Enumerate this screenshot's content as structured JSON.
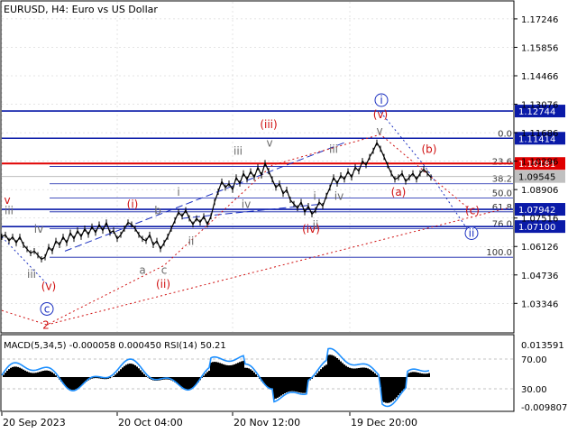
{
  "header": {
    "title": "EURUSD, H4:  Euro vs US Dollar",
    "indicator": "MACD(5,34,5) -0.000058 0.000450 RSI(14) 50.21"
  },
  "colors": {
    "price": "#000000",
    "blue_level": "#0a1aa8",
    "red_level": "#e00000",
    "wave_red": "#d01010",
    "wave_gray": "#6a6a6a",
    "wave_blue": "#1a2fc0",
    "rsi": "#1e90ff",
    "grid": "#c8c8c8"
  },
  "chart_data": {
    "type": "line",
    "symbol": "EURUSD",
    "timeframe": "H4",
    "y_ticks": [
      "1.17246",
      "1.15856",
      "1.14466",
      "1.13076",
      "1.11686",
      "1.10296",
      "1.08906",
      "1.07516",
      "1.06126",
      "1.04736",
      "1.03346"
    ],
    "ylim": [
      1.0195,
      1.1808
    ],
    "x_ticks": [
      "20 Sep 2023",
      "20 Oct 04:00",
      "20 Nov 12:00",
      "19 Dec 20:00"
    ],
    "price_labels": [
      {
        "text": "1.12744",
        "value": 1.12744,
        "style": "blue"
      },
      {
        "text": "1.11414",
        "value": 1.11414,
        "style": "blue"
      },
      {
        "text": "1.10181",
        "value": 1.10181,
        "style": "red"
      },
      {
        "text": "1.09545",
        "value": 1.09545,
        "style": "gray"
      },
      {
        "text": "1.07942",
        "value": 1.07942,
        "style": "blue"
      },
      {
        "text": "1.07100",
        "value": 1.071,
        "style": "blue"
      }
    ],
    "fib_levels": [
      {
        "label": "0.0",
        "value": 1.11414
      },
      {
        "label": "23.6",
        "value": 1.1004
      },
      {
        "label": "38.2",
        "value": 1.0919
      },
      {
        "label": "50.0",
        "value": 1.085
      },
      {
        "label": "61.8",
        "value": 1.0782
      },
      {
        "label": "76.0",
        "value": 1.0699
      },
      {
        "label": "100.0",
        "value": 1.056
      }
    ],
    "series": [
      {
        "type": "line",
        "values": [
          [
            0,
            1.066
          ],
          [
            4,
            1.067
          ],
          [
            8,
            1.064
          ],
          [
            12,
            1.066
          ],
          [
            16,
            1.063
          ],
          [
            20,
            1.066
          ],
          [
            24,
            1.062
          ],
          [
            28,
            1.06
          ],
          [
            32,
            1.058
          ],
          [
            36,
            1.059
          ],
          [
            40,
            1.057
          ],
          [
            44,
            1.055
          ],
          [
            48,
            1.056
          ],
          [
            52,
            1.061
          ],
          [
            56,
            1.059
          ],
          [
            60,
            1.064
          ],
          [
            64,
            1.062
          ],
          [
            68,
            1.066
          ],
          [
            72,
            1.063
          ],
          [
            76,
            1.068
          ],
          [
            80,
            1.065
          ],
          [
            84,
            1.069
          ],
          [
            88,
            1.066
          ],
          [
            92,
            1.07
          ],
          [
            96,
            1.067
          ],
          [
            100,
            1.071
          ],
          [
            104,
            1.068
          ],
          [
            108,
            1.072
          ],
          [
            112,
            1.069
          ],
          [
            116,
            1.073
          ],
          [
            120,
            1.068
          ],
          [
            124,
            1.069
          ],
          [
            128,
            1.065
          ],
          [
            132,
            1.067
          ],
          [
            136,
            1.07
          ],
          [
            140,
            1.073
          ],
          [
            144,
            1.072
          ],
          [
            148,
            1.07
          ],
          [
            152,
            1.067
          ],
          [
            156,
            1.065
          ],
          [
            160,
            1.064
          ],
          [
            164,
            1.067
          ],
          [
            168,
            1.062
          ],
          [
            172,
            1.064
          ],
          [
            176,
            1.06
          ],
          [
            180,
            1.063
          ],
          [
            184,
            1.066
          ],
          [
            188,
            1.07
          ],
          [
            192,
            1.074
          ],
          [
            196,
            1.078
          ],
          [
            200,
            1.076
          ],
          [
            204,
            1.079
          ],
          [
            208,
            1.075
          ],
          [
            212,
            1.072
          ],
          [
            216,
            1.075
          ],
          [
            220,
            1.073
          ],
          [
            224,
            1.076
          ],
          [
            228,
            1.072
          ],
          [
            232,
            1.076
          ],
          [
            236,
            1.083
          ],
          [
            240,
            1.088
          ],
          [
            244,
            1.093
          ],
          [
            248,
            1.09
          ],
          [
            252,
            1.092
          ],
          [
            256,
            1.089
          ],
          [
            260,
            1.095
          ],
          [
            264,
            1.092
          ],
          [
            268,
            1.097
          ],
          [
            272,
            1.094
          ],
          [
            276,
            1.098
          ],
          [
            280,
            1.095
          ],
          [
            284,
            1.1
          ],
          [
            288,
            1.096
          ],
          [
            292,
            1.102
          ],
          [
            296,
            1.098
          ],
          [
            300,
            1.094
          ],
          [
            304,
            1.09
          ],
          [
            308,
            1.092
          ],
          [
            312,
            1.087
          ],
          [
            316,
            1.089
          ],
          [
            320,
            1.084
          ],
          [
            324,
            1.082
          ],
          [
            328,
            1.08
          ],
          [
            332,
            1.083
          ],
          [
            336,
            1.078
          ],
          [
            340,
            1.081
          ],
          [
            344,
            1.077
          ],
          [
            348,
            1.079
          ],
          [
            352,
            1.083
          ],
          [
            356,
            1.081
          ],
          [
            360,
            1.086
          ],
          [
            364,
            1.09
          ],
          [
            368,
            1.095
          ],
          [
            372,
            1.092
          ],
          [
            376,
            1.096
          ],
          [
            380,
            1.094
          ],
          [
            384,
            1.098
          ],
          [
            388,
            1.095
          ],
          [
            392,
            1.1
          ],
          [
            396,
            1.098
          ],
          [
            400,
            1.103
          ],
          [
            404,
            1.101
          ],
          [
            408,
            1.105
          ],
          [
            412,
            1.108
          ],
          [
            416,
            1.112
          ],
          [
            420,
            1.109
          ],
          [
            424,
            1.105
          ],
          [
            428,
            1.101
          ],
          [
            432,
            1.097
          ],
          [
            436,
            1.094
          ],
          [
            440,
            1.095
          ],
          [
            444,
            1.097
          ],
          [
            448,
            1.093
          ],
          [
            452,
            1.095
          ],
          [
            456,
            1.097
          ],
          [
            460,
            1.094
          ],
          [
            464,
            1.097
          ],
          [
            468,
            1.099
          ],
          [
            472,
            1.097
          ],
          [
            476,
            1.095
          ]
        ]
      }
    ],
    "trend_lines": [
      {
        "style": "blue-dash",
        "points": [
          [
            70,
            1.059
          ],
          [
            380,
            1.112
          ]
        ]
      },
      {
        "style": "blue-dash",
        "points": [
          [
            200,
            1.075
          ],
          [
            355,
            1.082
          ]
        ]
      },
      {
        "style": "red-dot",
        "points": [
          [
            0,
            1.03
          ],
          [
            50,
            1.023
          ],
          [
            180,
            1.052
          ],
          [
            300,
            1.101
          ],
          [
            420,
            1.116
          ],
          [
            520,
            1.079
          ]
        ]
      },
      {
        "style": "red-dot",
        "points": [
          [
            50,
            1.023
          ],
          [
            560,
            1.08
          ]
        ]
      },
      {
        "style": "blue-dot",
        "points": [
          [
            420,
            1.127
          ],
          [
            470,
            1.1
          ],
          [
            522,
            1.066
          ]
        ]
      },
      {
        "style": "blue-dot",
        "points": [
          [
            0,
            1.066
          ],
          [
            50,
            1.043
          ]
        ]
      }
    ],
    "wave_labels": [
      {
        "text": "v",
        "t": 6,
        "y": 1.082,
        "color": "red"
      },
      {
        "text": "iii",
        "t": 8,
        "y": 1.077,
        "color": "gray"
      },
      {
        "text": "iv",
        "t": 41,
        "y": 1.068,
        "color": "gray"
      },
      {
        "text": "iii",
        "t": 33,
        "y": 1.046,
        "color": "gray"
      },
      {
        "text": "(v)",
        "t": 52,
        "y": 1.04,
        "color": "red"
      },
      {
        "text": "c",
        "t": 50,
        "y": 1.029,
        "color": "blue-circle"
      },
      {
        "text": "2",
        "t": 49,
        "y": 1.021,
        "color": "red"
      },
      {
        "text": "(i)",
        "t": 145,
        "y": 1.08,
        "color": "red"
      },
      {
        "text": "i",
        "t": 196,
        "y": 1.086,
        "color": "gray"
      },
      {
        "text": "b",
        "t": 173,
        "y": 1.077,
        "color": "gray"
      },
      {
        "text": "ii",
        "t": 210,
        "y": 1.062,
        "color": "gray"
      },
      {
        "text": "a",
        "t": 156,
        "y": 1.048,
        "color": "gray"
      },
      {
        "text": "c",
        "t": 180,
        "y": 1.048,
        "color": "gray"
      },
      {
        "text": "(ii)",
        "t": 179,
        "y": 1.041,
        "color": "red"
      },
      {
        "text": "iii",
        "t": 262,
        "y": 1.106,
        "color": "gray"
      },
      {
        "text": "iv",
        "t": 271,
        "y": 1.08,
        "color": "gray"
      },
      {
        "text": "(iii)",
        "t": 296,
        "y": 1.119,
        "color": "red"
      },
      {
        "text": "v",
        "t": 297,
        "y": 1.11,
        "color": "gray"
      },
      {
        "text": "i",
        "t": 347,
        "y": 1.084,
        "color": "gray"
      },
      {
        "text": "ii",
        "t": 348,
        "y": 1.07,
        "color": "gray"
      },
      {
        "text": "(iv)",
        "t": 343,
        "y": 1.068,
        "color": "red"
      },
      {
        "text": "iii",
        "t": 368,
        "y": 1.107,
        "color": "gray"
      },
      {
        "text": "iv",
        "t": 374,
        "y": 1.084,
        "color": "gray"
      },
      {
        "text": "i",
        "t": 421,
        "y": 1.131,
        "color": "blue-circle"
      },
      {
        "text": "(v)",
        "t": 420,
        "y": 1.124,
        "color": "red"
      },
      {
        "text": "v",
        "t": 419,
        "y": 1.116,
        "color": "gray"
      },
      {
        "text": "(b)",
        "t": 474,
        "y": 1.107,
        "color": "red"
      },
      {
        "text": "(a)",
        "t": 440,
        "y": 1.086,
        "color": "red"
      },
      {
        "text": "(c)",
        "t": 522,
        "y": 1.077,
        "color": "red"
      },
      {
        "text": "ii",
        "t": 521,
        "y": 1.066,
        "color": "blue-circle"
      }
    ]
  },
  "indicator_panel": {
    "labels": [
      "0.013591",
      "70.00",
      "30.00",
      "-0.009807"
    ]
  }
}
